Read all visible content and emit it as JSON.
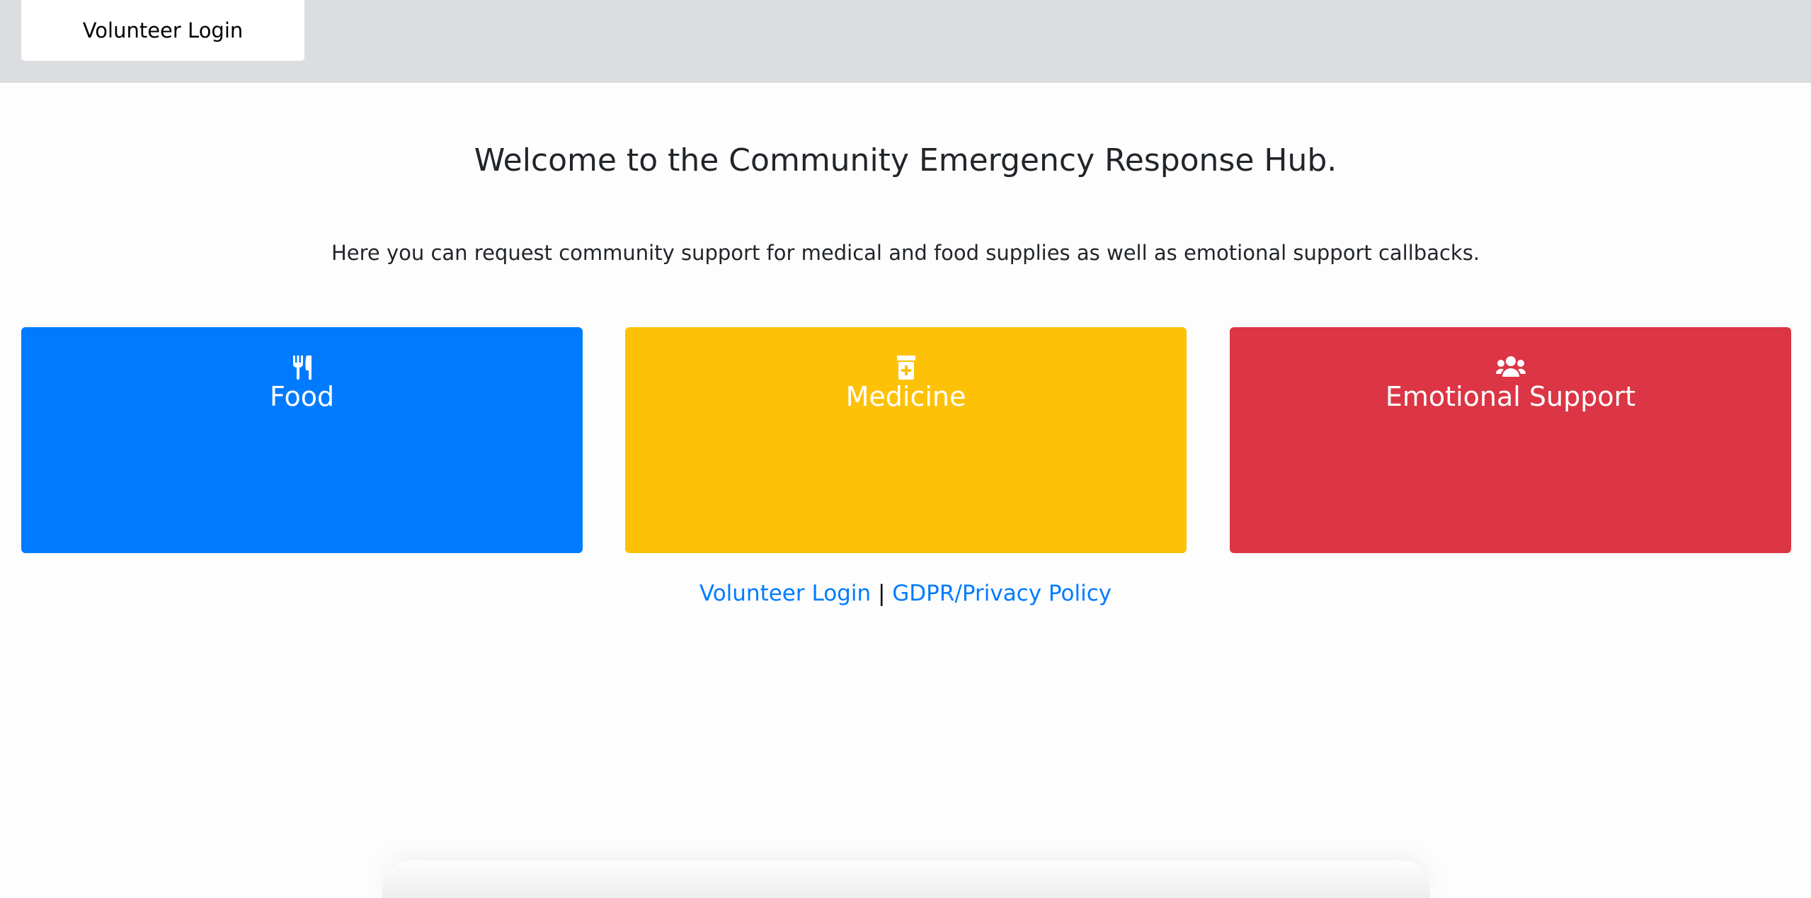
{
  "header": {
    "login_label": "Volunteer Login"
  },
  "main": {
    "title": "Welcome to the Community Emergency Response Hub.",
    "subtitle": "Here you can request community support for medical and food supplies as well as emotional support callbacks."
  },
  "cards": [
    {
      "label": "Food",
      "icon": "utensils-icon",
      "color": "#007bff"
    },
    {
      "label": "Medicine",
      "icon": "prescription-bottle-icon",
      "color": "#fdc107"
    },
    {
      "label": "Emotional Support",
      "icon": "users-icon",
      "color": "#dc3545"
    }
  ],
  "footer": {
    "login_link": "Volunteer Login",
    "separator": "|",
    "privacy_link": "GDPR/Privacy Policy",
    "link_color": "#007bff"
  }
}
